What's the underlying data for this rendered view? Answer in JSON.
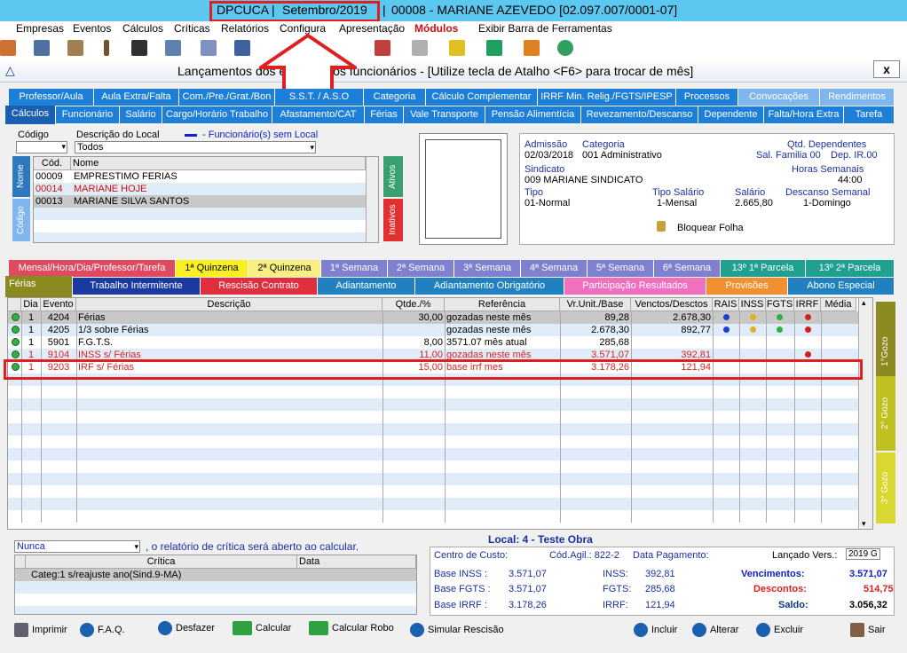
{
  "title": {
    "company": "DPCUCA",
    "period": "Setembro/2019",
    "sep": "|",
    "employee": "00008 - MARIANE AZEVEDO [02.097.007/0001-07]"
  },
  "menu": [
    "Empresas",
    "Eventos",
    "Cálculos",
    "Críticas",
    "Relatórios",
    "Configura",
    "Apresentação",
    "Módulos",
    "Exibir Barra de Ferramentas"
  ],
  "dialog": {
    "title": "Lançamentos dos eventos dos funcionários - [Utilize tecla de Atalho <F6> para trocar de mês]",
    "close": "x"
  },
  "tabs_row1": [
    "Professor/Aula",
    "Aula Extra/Falta",
    "Com./Pre./Grat./Bon",
    "S.S.T. / A.S.O",
    "Categoria",
    "Cálculo Complementar",
    "IRRF Min. Relig./FGTS/IPESP",
    "Processos",
    "Convocações",
    "Rendimentos"
  ],
  "tabs_row2": [
    "Cálculos",
    "Funcionário",
    "Salário",
    "Cargo/Horário Trabalho",
    "Afastamento/CAT",
    "Férias",
    "Vale Transporte",
    "Pensão Alimentícia",
    "Revezamento/Descanso",
    "Dependente",
    "Falta/Hora Extra",
    "Tarefa"
  ],
  "filter": {
    "codigo_label": "Código",
    "desc_label": "Descrição do Local",
    "desc_value": "Todos",
    "legend": "- Funcionário(s) sem Local"
  },
  "emp_grid": {
    "h_cod": "Cód.",
    "h_nome": "Nome",
    "rows": [
      {
        "cod": "00009",
        "nome": "EMPRESTIMO FERIAS"
      },
      {
        "cod": "00014",
        "nome": "MARIANE HOJE"
      },
      {
        "cod": "00013",
        "nome": "MARIANE SILVA SANTOS"
      }
    ],
    "side_nome": "Nome",
    "side_codigo": "Código",
    "ativos": "Ativos",
    "inativos": "Inativos"
  },
  "info": {
    "admissao_l": "Admissão",
    "admissao": "02/03/2018",
    "categoria_l": "Categoria",
    "categoria": "001  Administrativo",
    "qtd_dep_l": "Qtd. Dependentes",
    "sal_familia": "Sal. Familia 00",
    "dep_ir": "Dep. IR.00",
    "sindicato_l": "Sindicato",
    "sindicato": "009  MARIANE SINDICATO",
    "horas_l": "Horas Semanais",
    "horas": "44:00",
    "tipo_l": "Tipo",
    "tipo": "01-Normal",
    "tipo_sal_l": "Tipo Salário",
    "tipo_sal": "1-Mensal",
    "salario_l": "Salário",
    "salario": "2.665,80",
    "descanso_l": "Descanso Semanal",
    "descanso": "1-Domingo",
    "bloquear": "Bloquear Folha"
  },
  "tabs_row3": [
    "Mensal/Hora/Dia/Professor/Tarefa",
    "1ª Quinzena",
    "2ª Quinzena",
    "1ª Semana",
    "2ª Semana",
    "3ª Semana",
    "4ª Semana",
    "5ª Semana",
    "6ª Semana",
    "13º  1ª Parcela",
    "13º  2ª Parcela"
  ],
  "tabs_row4": [
    "Férias",
    "Trabalho Intermitente",
    "Rescisão Contrato",
    "Adiantamento",
    "Adiantamento Obrigatório",
    "Participação Resultados",
    "Provisões",
    "Abono Especial"
  ],
  "ev_headers": [
    "Dia",
    "Evento",
    "Descrição",
    "Qtde./%",
    "Referência",
    "Vr.Unit./Base",
    "Venctos/Desctos",
    "RAIS",
    "INSS",
    "FGTS",
    "IRRF",
    "Média"
  ],
  "events": [
    {
      "dia": "1",
      "ev": "4204",
      "desc": "Férias",
      "qtde": "30,00",
      "ref": "gozadas neste mês",
      "unit": "89,28",
      "venc": "2.678,30"
    },
    {
      "dia": "1",
      "ev": "4205",
      "desc": "1/3 sobre Férias",
      "qtde": "",
      "ref": "gozadas neste mês",
      "unit": "2.678,30",
      "venc": "892,77"
    },
    {
      "dia": "1",
      "ev": "5901",
      "desc": "F.G.T.S.",
      "qtde": "8,00",
      "ref": "3571.07 mês atual",
      "unit": "285,68",
      "venc": ""
    },
    {
      "dia": "1",
      "ev": "9104",
      "desc": "INSS s/ Férias",
      "qtde": "11,00",
      "ref": "gozadas neste mês",
      "unit": "3.571,07",
      "venc": "392,81"
    },
    {
      "dia": "1",
      "ev": "9203",
      "desc": "IRF s/ Férias",
      "qtde": "15,00",
      "ref": "base irrf mes",
      "unit": "3.178,26",
      "venc": "121,94"
    }
  ],
  "gozo": [
    "1°Gozo",
    "2° Gozo",
    "3° Gozo"
  ],
  "critica": {
    "select": "Nunca",
    "text": ", o relatório de crítica será aberto ao calcular.",
    "h_critica": "Crítica",
    "h_data": "Data",
    "row": "Categ:1 s/reajuste ano(Sind.9-MA)"
  },
  "totals": {
    "local": "Local: 4 - Teste Obra",
    "centro": "Centro de Custo:",
    "cod_agil": "Cód.Agil.:  822-2",
    "data_pag": "Data Pagamento:",
    "lancado": "Lançado Vers.:",
    "versao": "2019 G",
    "base_inss_l": "Base INSS :",
    "base_inss": "3.571,07",
    "inss_l": "INSS:",
    "inss": "392,81",
    "venc_l": "Vencimentos:",
    "venc": "3.571,07",
    "base_fgts_l": "Base FGTS :",
    "base_fgts": "3.571,07",
    "fgts_l": "FGTS:",
    "fgts": "285,68",
    "desc_l": "Descontos:",
    "desc": "514,75",
    "base_irrf_l": "Base IRRF :",
    "base_irrf": "3.178,26",
    "irrf_l": "IRRF:",
    "irrf": "121,94",
    "saldo_l": "Saldo:",
    "saldo": "3.056,32"
  },
  "buttons": {
    "imprimir": "Imprimir",
    "faq": "F.A.Q.",
    "desfazer": "Desfazer",
    "calcular": "Calcular",
    "calcular_robo": "Calcular Robo",
    "simular": "Simular Rescisão",
    "incluir": "Incluir",
    "alterar": "Alterar",
    "excluir": "Excluir",
    "sair": "Sair"
  },
  "colors": {
    "accent": "#1e7fd8",
    "highlight": "#e02020"
  }
}
